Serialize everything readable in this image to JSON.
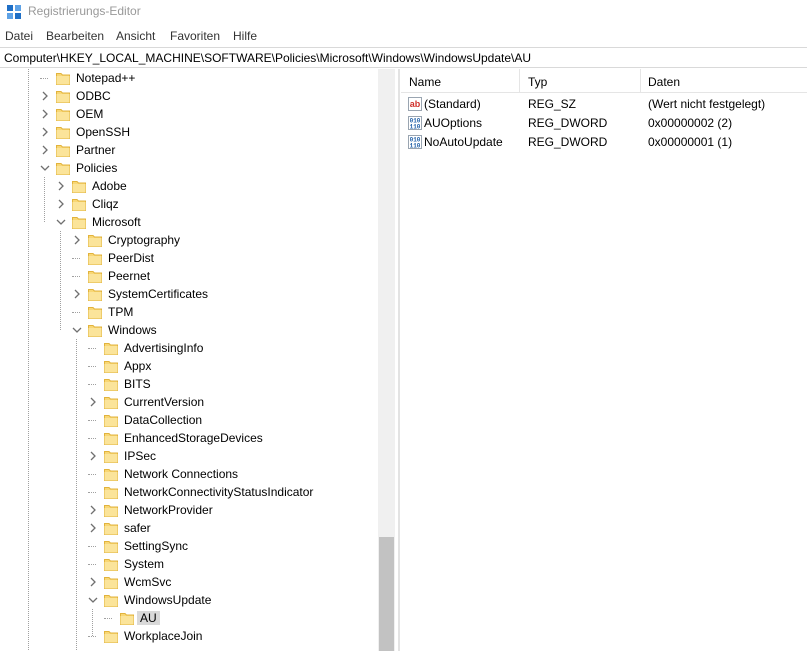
{
  "window": {
    "title": "Registrierungs-Editor",
    "icon": "regedit-icon"
  },
  "menu": [
    {
      "label": "Datei"
    },
    {
      "label": "Bearbeiten"
    },
    {
      "label": "Ansicht"
    },
    {
      "label": "Favoriten"
    },
    {
      "label": "Hilfe"
    }
  ],
  "address": {
    "path": "Computer\\HKEY_LOCAL_MACHINE\\SOFTWARE\\Policies\\Microsoft\\Windows\\WindowsUpdate\\AU"
  },
  "tree": {
    "items": [
      {
        "label": "Notepad++",
        "depth": 0,
        "expander": "none",
        "selected": false
      },
      {
        "label": "ODBC",
        "depth": 0,
        "expander": "collapsed",
        "selected": false
      },
      {
        "label": "OEM",
        "depth": 0,
        "expander": "collapsed",
        "selected": false
      },
      {
        "label": "OpenSSH",
        "depth": 0,
        "expander": "collapsed",
        "selected": false
      },
      {
        "label": "Partner",
        "depth": 0,
        "expander": "collapsed",
        "selected": false
      },
      {
        "label": "Policies",
        "depth": 0,
        "expander": "expanded",
        "selected": false
      },
      {
        "label": "Adobe",
        "depth": 1,
        "expander": "collapsed",
        "selected": false
      },
      {
        "label": "Cliqz",
        "depth": 1,
        "expander": "collapsed",
        "selected": false
      },
      {
        "label": "Microsoft",
        "depth": 1,
        "expander": "expanded",
        "selected": false
      },
      {
        "label": "Cryptography",
        "depth": 2,
        "expander": "collapsed",
        "selected": false
      },
      {
        "label": "PeerDist",
        "depth": 2,
        "expander": "none",
        "selected": false
      },
      {
        "label": "Peernet",
        "depth": 2,
        "expander": "none",
        "selected": false
      },
      {
        "label": "SystemCertificates",
        "depth": 2,
        "expander": "collapsed",
        "selected": false
      },
      {
        "label": "TPM",
        "depth": 2,
        "expander": "none",
        "selected": false
      },
      {
        "label": "Windows",
        "depth": 2,
        "expander": "expanded",
        "selected": false
      },
      {
        "label": "AdvertisingInfo",
        "depth": 3,
        "expander": "none",
        "selected": false
      },
      {
        "label": "Appx",
        "depth": 3,
        "expander": "none",
        "selected": false
      },
      {
        "label": "BITS",
        "depth": 3,
        "expander": "none",
        "selected": false
      },
      {
        "label": "CurrentVersion",
        "depth": 3,
        "expander": "collapsed",
        "selected": false
      },
      {
        "label": "DataCollection",
        "depth": 3,
        "expander": "none",
        "selected": false
      },
      {
        "label": "EnhancedStorageDevices",
        "depth": 3,
        "expander": "none",
        "selected": false
      },
      {
        "label": "IPSec",
        "depth": 3,
        "expander": "collapsed",
        "selected": false
      },
      {
        "label": "Network Connections",
        "depth": 3,
        "expander": "none",
        "selected": false
      },
      {
        "label": "NetworkConnectivityStatusIndicator",
        "depth": 3,
        "expander": "none",
        "selected": false
      },
      {
        "label": "NetworkProvider",
        "depth": 3,
        "expander": "collapsed",
        "selected": false
      },
      {
        "label": "safer",
        "depth": 3,
        "expander": "collapsed",
        "selected": false
      },
      {
        "label": "SettingSync",
        "depth": 3,
        "expander": "none",
        "selected": false
      },
      {
        "label": "System",
        "depth": 3,
        "expander": "none",
        "selected": false
      },
      {
        "label": "WcmSvc",
        "depth": 3,
        "expander": "collapsed",
        "selected": false
      },
      {
        "label": "WindowsUpdate",
        "depth": 3,
        "expander": "expanded",
        "selected": false
      },
      {
        "label": "AU",
        "depth": 4,
        "expander": "none",
        "selected": true
      },
      {
        "label": "WorkplaceJoin",
        "depth": 3,
        "expander": "none",
        "selected": false
      }
    ]
  },
  "values": {
    "columns": {
      "name": "Name",
      "type": "Typ",
      "data": "Daten"
    },
    "rows": [
      {
        "name": "(Standard)",
        "type": "REG_SZ",
        "data": "(Wert nicht festgelegt)",
        "icon": "string-value-icon"
      },
      {
        "name": "AUOptions",
        "type": "REG_DWORD",
        "data": "0x00000002 (2)",
        "icon": "binary-value-icon"
      },
      {
        "name": "NoAutoUpdate",
        "type": "REG_DWORD",
        "data": "0x00000001 (1)",
        "icon": "binary-value-icon"
      }
    ]
  },
  "colors": {
    "folder": "#f8d775",
    "folder_dark": "#e2b33c",
    "selection": "#d9d9d9",
    "icon_blue": "#1f5fa8",
    "icon_red": "#d0302a"
  }
}
